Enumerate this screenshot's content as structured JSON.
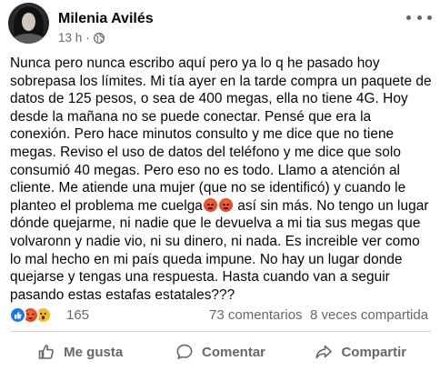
{
  "post": {
    "author": "Milenia Avilés",
    "time": "13 h",
    "separator": "·",
    "audience_icon": "globe-icon",
    "more_icon": "more-options-icon",
    "text_part1": "Nunca pero nunca escribo aquí pero ya lo q he pasado hoy sobrepasa los límites. Mi tía ayer en la tarde compra un paquete de datos de 125 pesos, o sea de 400 megas, ella no tiene 4G. Hoy desde la mañana no se puede conectar. Pensé que era la conexión. Pero hace minutos consulto y me dice que no tiene megas. Reviso el uso de datos del teléfono y me dice que solo consumió 40 megas. Pero eso no es todo. Llamo a atención al cliente. Me atiende una mujer (que no se identificó) y cuando le planteo el problema me cuelga",
    "inline_emojis": [
      "angry-face",
      "angry-face"
    ],
    "text_part2": " así sin más. No tengo un lugar dónde quejarme, ni nadie que le devuelva a mi tia sus megas que volvaronn y nadie vio, ni su dinero, ni nada. Es increible ver como lo mal hecho en mi país queda impune. No hay un lugar donde quejarse y tengas una respuesta. Hasta cuando van a seguir pasando estas estafas estatales???"
  },
  "stats": {
    "reaction_icons": [
      "like",
      "angry",
      "wow"
    ],
    "reaction_count": "165",
    "comments": "73 comentarios",
    "shares": "8 veces compartida"
  },
  "actions": {
    "like_label": "Me gusta",
    "comment_label": "Comentar",
    "share_label": "Compartir"
  },
  "colors": {
    "secondary_text": "#65676b",
    "primary_text": "#050505",
    "like_blue": "#1877f2",
    "divider": "#ced0d4"
  }
}
